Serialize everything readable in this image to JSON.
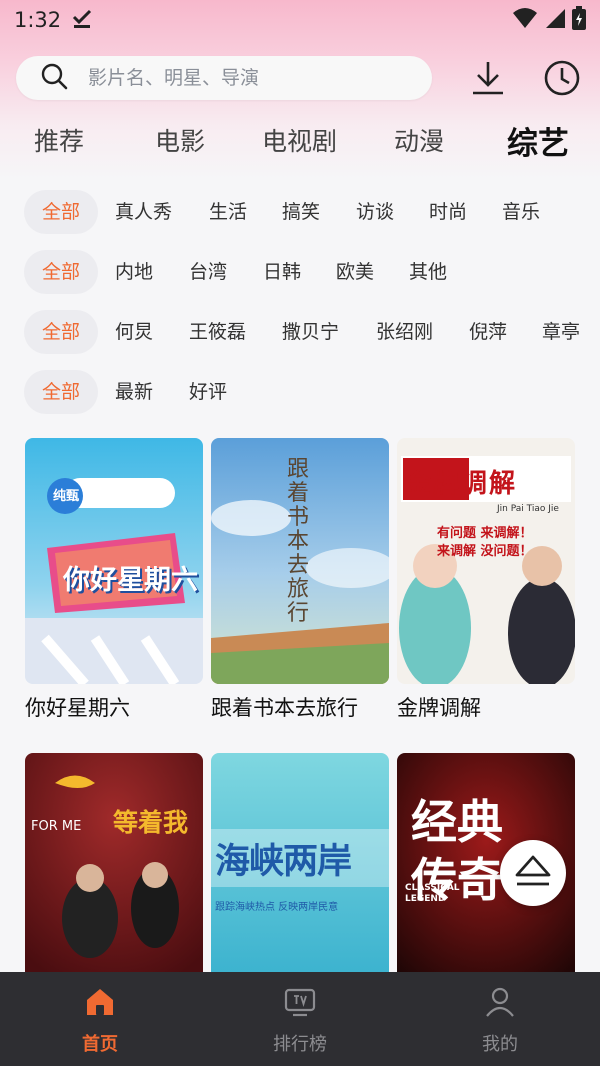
{
  "status": {
    "time": "1:32"
  },
  "search": {
    "placeholder": "影片名、明星、导演"
  },
  "tabs": [
    {
      "label": "推荐"
    },
    {
      "label": "电影"
    },
    {
      "label": "电视剧"
    },
    {
      "label": "动漫"
    },
    {
      "label": "综艺",
      "active": true
    }
  ],
  "filters": {
    "row1": [
      "全部",
      "真人秀",
      "生活",
      "搞笑",
      "访谈",
      "时尚",
      "音乐"
    ],
    "row2": [
      "全部",
      "内地",
      "台湾",
      "日韩",
      "欧美",
      "其他"
    ],
    "row3": [
      "全部",
      "何炅",
      "王筱磊",
      "撒贝宁",
      "张绍刚",
      "倪萍",
      "章亭"
    ],
    "row4": [
      "全部",
      "最新",
      "好评"
    ]
  },
  "shows": [
    {
      "title": "你好星期六",
      "poster_text": "你好星期六",
      "poster_sub": "纯甄 甄酸奶"
    },
    {
      "title": "跟着书本去旅行",
      "poster_text": "跟着书本去旅行",
      "poster_sub": ""
    },
    {
      "title": "金牌调解",
      "poster_text": "金牌调解",
      "poster_sub": "Jin Pai  Tiao Jie",
      "poster_sub2": "有问题 来调解！",
      "poster_sub3": "来调解 没问题！"
    },
    {
      "title": "",
      "poster_text": "等着我",
      "poster_sub": "FOR ME"
    },
    {
      "title": "",
      "poster_text": "海峡两岸",
      "poster_sub": "跟踪海峡热点   反映两岸民意"
    },
    {
      "title": "",
      "poster_text": "经典传奇",
      "poster_sub": "CLASSICAL LEGEND"
    }
  ],
  "nav": [
    {
      "label": "首页",
      "icon": "home-icon",
      "active": true
    },
    {
      "label": "排行榜",
      "icon": "tv-icon"
    },
    {
      "label": "我的",
      "icon": "user-icon"
    }
  ],
  "colors": {
    "accent": "#f06a32",
    "nav_bg": "#2e2e32",
    "chip_bg": "#ececf0"
  }
}
